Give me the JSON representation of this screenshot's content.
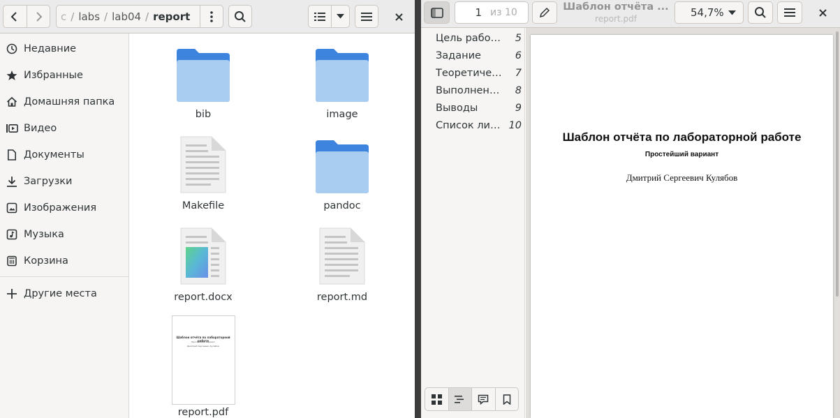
{
  "file_manager": {
    "path": {
      "hidden": "c",
      "segments": [
        "labs",
        "lab04"
      ],
      "current": "report",
      "separator": "/"
    },
    "sidebar": {
      "items": [
        {
          "label": "Недавние",
          "icon": "clock-icon"
        },
        {
          "label": "Избранные",
          "icon": "star-icon"
        },
        {
          "label": "Домашняя папка",
          "icon": "home-icon"
        },
        {
          "label": "Видео",
          "icon": "video-icon"
        },
        {
          "label": "Документы",
          "icon": "document-icon"
        },
        {
          "label": "Загрузки",
          "icon": "download-icon"
        },
        {
          "label": "Изображения",
          "icon": "image-icon"
        },
        {
          "label": "Музыка",
          "icon": "music-icon"
        },
        {
          "label": "Корзина",
          "icon": "trash-icon"
        }
      ],
      "other_places": "Другие места"
    },
    "files": [
      {
        "name": "bib",
        "type": "folder"
      },
      {
        "name": "image",
        "type": "folder"
      },
      {
        "name": "Makefile",
        "type": "text"
      },
      {
        "name": "pandoc",
        "type": "folder"
      },
      {
        "name": "report.docx",
        "type": "docx"
      },
      {
        "name": "report.md",
        "type": "text"
      },
      {
        "name": "report.pdf",
        "type": "pdf"
      }
    ],
    "pdf_thumb": {
      "title": "Шаблон отчёта по лабораторной работе",
      "subtitle": "Простейший вариант",
      "author": "Дмитрий Сергеевич Кулябов"
    }
  },
  "doc_viewer": {
    "page_current": "1",
    "page_of": "из 10",
    "title": "Шаблон отчёта ...",
    "filename": "report.pdf",
    "zoom": "54,7%",
    "outline": [
      {
        "label": "Цель работы",
        "page": "5"
      },
      {
        "label": "Задание",
        "page": "6"
      },
      {
        "label": "Теоретическое введение",
        "page": "7"
      },
      {
        "label": "Выполнение лабораторной работы",
        "page": "8"
      },
      {
        "label": "Выводы",
        "page": "9"
      },
      {
        "label": "Список литературы",
        "page": "10"
      }
    ],
    "page": {
      "title": "Шаблон отчёта по лабораторной работе",
      "subtitle": "Простейший вариант",
      "author": "Дмитрий Сергеевич Кулябов"
    }
  },
  "colors": {
    "folder_top": "#3c84dd",
    "folder_body": "#a9cdf1",
    "accent": "#3584e4"
  }
}
